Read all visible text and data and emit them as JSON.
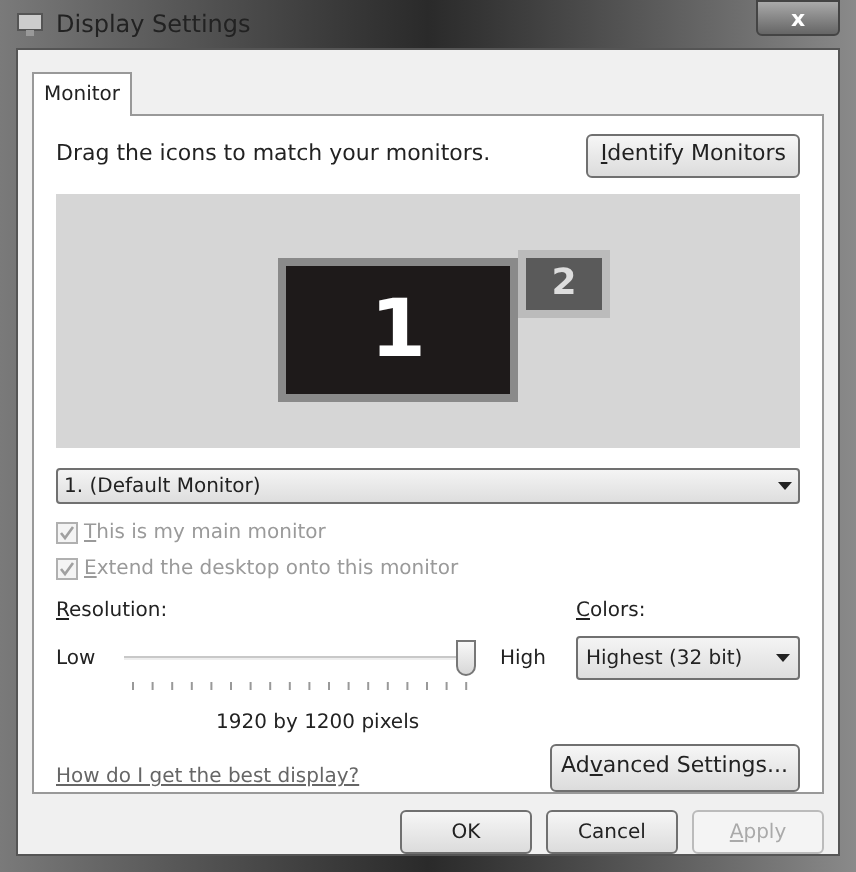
{
  "window": {
    "title": "Display Settings",
    "close": "x"
  },
  "tabs": [
    {
      "label": "Monitor",
      "selected": true
    }
  ],
  "instruction": "Drag the icons to match your monitors.",
  "identify_button": {
    "key": "I",
    "post": "dentify Monitors"
  },
  "monitors": [
    {
      "number": "1",
      "selected": true
    },
    {
      "number": "2",
      "selected": false
    }
  ],
  "monitor_select": {
    "value": "1. (Default Monitor)"
  },
  "checkboxes": [
    {
      "key": "T",
      "post": "his is my main monitor",
      "checked": true,
      "disabled": true
    },
    {
      "key": "E",
      "post": "xtend the desktop onto this monitor",
      "checked": true,
      "disabled": true
    }
  ],
  "resolution": {
    "label": {
      "key": "R",
      "post": "esolution:"
    },
    "low": "Low",
    "high": "High",
    "level": 1,
    "reading": "1920 by 1200 pixels"
  },
  "colors": {
    "label": {
      "key": "C",
      "post": "olors:"
    },
    "value": "Highest (32 bit)"
  },
  "help_link": "How do I get the best display?",
  "advanced_button": {
    "pre": "Ad",
    "key": "v",
    "post": "anced Settings..."
  },
  "buttons": [
    {
      "pre": "OK",
      "disabled": false
    },
    {
      "pre": "Cancel",
      "disabled": false
    },
    {
      "key": "A",
      "post": "pply",
      "disabled": true
    }
  ]
}
